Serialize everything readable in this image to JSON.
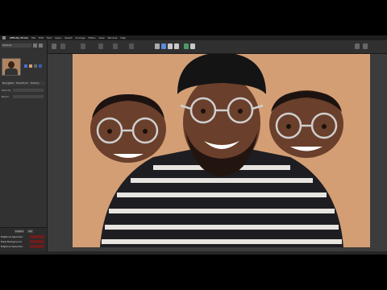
{
  "menubar": {
    "app_name": "Affinity Photo",
    "items": [
      "File",
      "Edit",
      "Text",
      "Layer",
      "Select",
      "Arrange",
      "Filters",
      "View",
      "Window",
      "Help"
    ]
  },
  "left_panel": {
    "preset_select": "Default",
    "tabs": [
      "Navigator",
      "Transform",
      "History"
    ],
    "fields": [
      {
        "label": "Opacity"
      },
      {
        "label": "Blend"
      }
    ],
    "layers_buttons": [
      "Layers",
      "Adj"
    ],
    "layers": [
      {
        "name": "Elliptical Selection"
      },
      {
        "name": "Pixel Background"
      },
      {
        "name": "Elliptical Selection"
      }
    ]
  },
  "canvas": {
    "background_color": "#d49e75"
  },
  "colors": {
    "accent": "#5b8ad8",
    "swatch_blue": "#4a6fcf",
    "swatch_orange": "#d49e75"
  }
}
